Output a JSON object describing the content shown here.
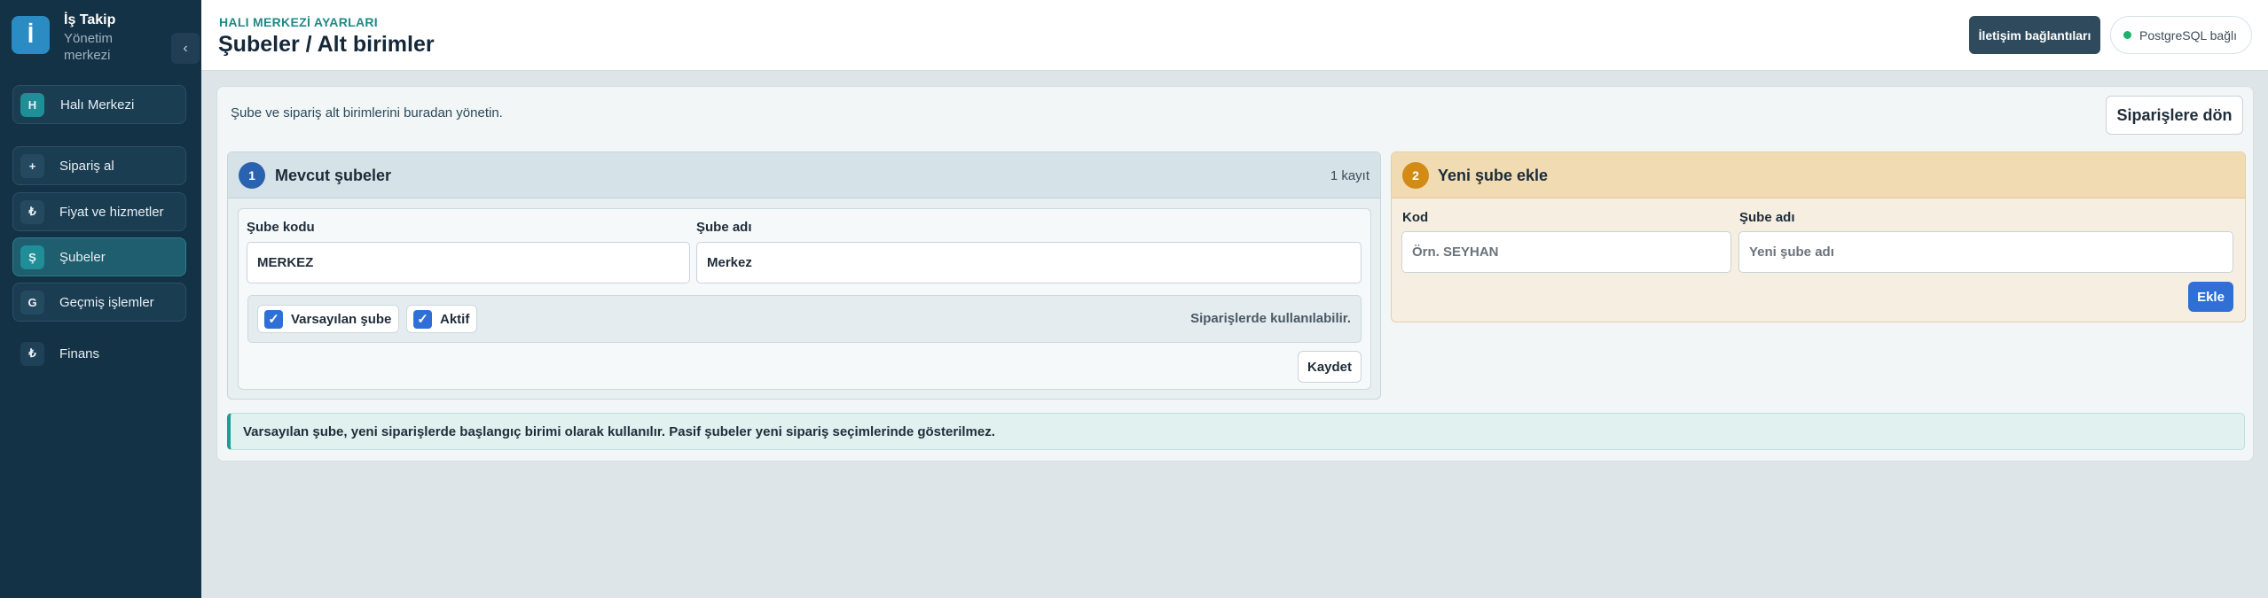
{
  "sidebar": {
    "brand": {
      "logo_letter": "İ",
      "title": "İş Takip",
      "subtitle": "Yönetim merkezi"
    },
    "collapse_glyph": "‹",
    "top_item": {
      "badge": "H",
      "label": "Halı Merkezi"
    },
    "items": [
      {
        "badge": "+",
        "label": "Sipariş al",
        "active": false
      },
      {
        "badge": "₺",
        "label": "Fiyat ve hizmetler",
        "active": false
      },
      {
        "badge": "Ş",
        "label": "Şubeler",
        "active": true
      },
      {
        "badge": "G",
        "label": "Geçmiş işlemler",
        "active": false
      }
    ],
    "finance": {
      "badge": "₺",
      "label": "Finans"
    }
  },
  "header": {
    "eyebrow": "HALI MERKEZİ AYARLARI",
    "title": "Şubeler / Alt birimler",
    "connections_button": "İletişim bağlantıları",
    "db_status": "PostgreSQL bağlı",
    "db_status_color": "#19b36b"
  },
  "main": {
    "description": "Şube ve sipariş alt birimlerini buradan yönetin.",
    "back_button": "Siparişlere dön",
    "existing": {
      "step": "1",
      "title": "Mevcut şubeler",
      "count": "1 kayıt",
      "code_label": "Şube kodu",
      "code_value": "MERKEZ",
      "name_label": "Şube adı",
      "name_value": "Merkez",
      "default_label": "Varsayılan şube",
      "active_label": "Aktif",
      "check_glyph": "✓",
      "usage_hint": "Siparişlerde kullanılabilir.",
      "save_button": "Kaydet"
    },
    "new_branch": {
      "step": "2",
      "title": "Yeni şube ekle",
      "code_label": "Kod",
      "code_placeholder": "Örn. SEYHAN",
      "name_label": "Şube adı",
      "name_placeholder": "Yeni şube adı",
      "add_button": "Ekle"
    },
    "note": "Varsayılan şube, yeni siparişlerde başlangıç birimi olarak kullanılır. Pasif şubeler yeni sipariş seçimlerinde gösterilmez."
  },
  "colors": {
    "sidebar_bg": "#143246",
    "accent_teal": "#1d8a86",
    "primary_blue": "#2f6fd6",
    "step_orange": "#d28b15"
  }
}
